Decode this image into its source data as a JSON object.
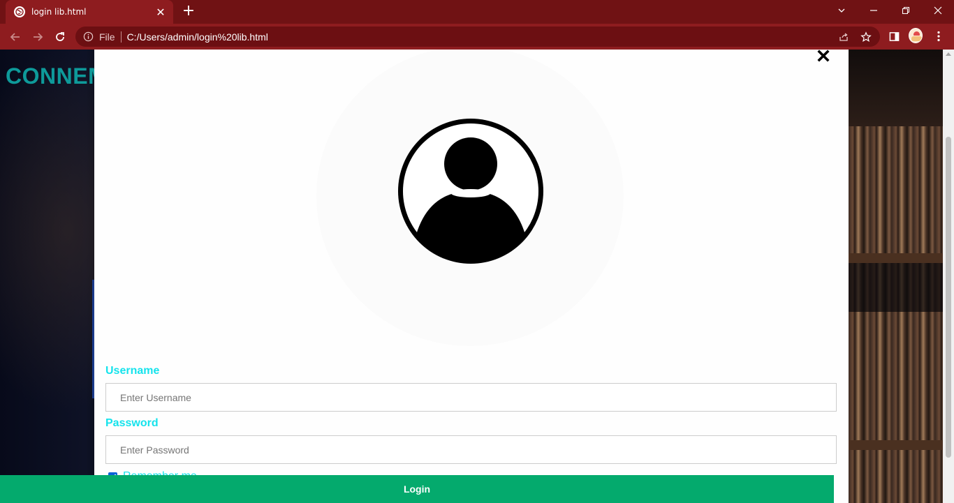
{
  "browser": {
    "tab_title": "login lib.html",
    "tab_close": "✕",
    "new_tab": "+",
    "omnibox": {
      "scheme_label": "File",
      "url": "C:/Users/admin/login%20lib.html"
    }
  },
  "page": {
    "site_title": "CONNEM",
    "modal": {
      "close_label": "×",
      "avatar_alt": "Avatar",
      "username_label": "Username",
      "username_placeholder": "Enter Username",
      "password_label": "Password",
      "password_placeholder": "Enter Password",
      "remember_label": "Remember me",
      "remember_checked": true,
      "login_button": "Login"
    }
  },
  "colors": {
    "tab_strip": "#701214",
    "toolbar": "#8e1c1f",
    "label_cyan": "#15e3ec",
    "title_teal": "#0e9a9a",
    "login_green": "#04aa6d"
  }
}
